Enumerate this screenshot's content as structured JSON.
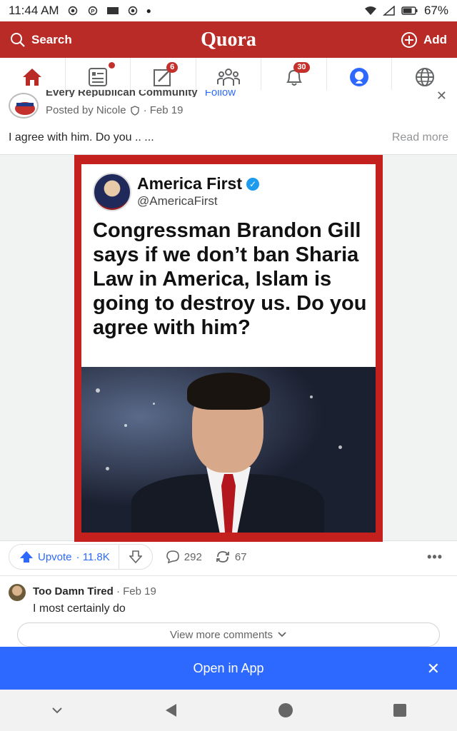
{
  "status_bar": {
    "time": "11:44 AM",
    "battery": "67%"
  },
  "top_bar": {
    "search_label": "Search",
    "logo": "Quora",
    "add_label": "Add",
    "color": "#b92b27"
  },
  "nav": {
    "items": [
      {
        "name": "home",
        "icon": "home-icon",
        "active": true
      },
      {
        "name": "following",
        "icon": "feed-icon",
        "dot": true
      },
      {
        "name": "answer",
        "icon": "pencil-square-icon",
        "badge": "6"
      },
      {
        "name": "spaces",
        "icon": "people-icon"
      },
      {
        "name": "notifications",
        "icon": "bell-icon",
        "badge": "30"
      },
      {
        "name": "profile",
        "icon": "profile-icon"
      },
      {
        "name": "languages",
        "icon": "globe-icon"
      }
    ]
  },
  "post": {
    "space_name": "Every Republican Community",
    "follow_label": "Follow",
    "posted_by": "Posted by Nicole",
    "date": "· Feb 19",
    "text": "I agree with him. Do you .. ...",
    "read_more": "Read more",
    "image": {
      "tweet_name": "America First",
      "tweet_handle": "@AmericaFirst",
      "tweet_text": "Congressman Brandon Gill says if we don’t ban Sharia Law in America, Islam is going to destroy us. Do you agree with him?"
    }
  },
  "actions": {
    "upvote_label": "Upvote",
    "upvote_count": "· 11.8K",
    "comments": "292",
    "shares": "67"
  },
  "comment": {
    "author": "Too Damn Tired",
    "date": "· Feb 19",
    "text": "I most certainly do",
    "view_more": "View more comments"
  },
  "banner": {
    "label": "Open in App",
    "color": "#2e69ff"
  }
}
